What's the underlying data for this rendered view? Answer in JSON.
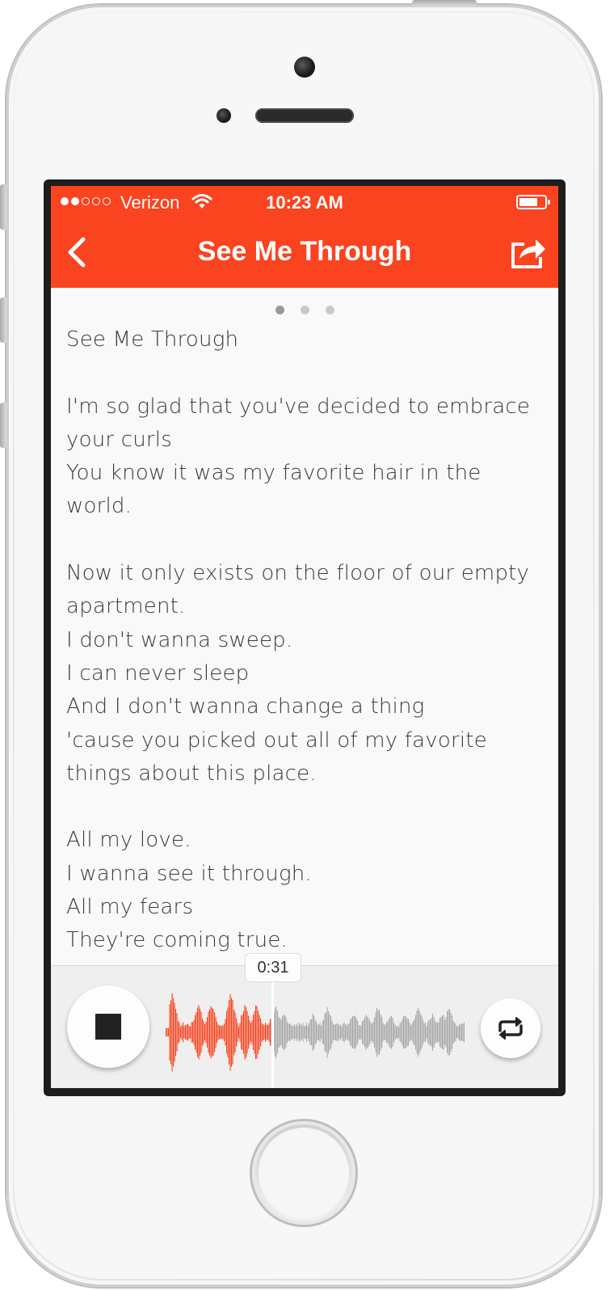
{
  "status_bar": {
    "signal_dots_filled": 2,
    "signal_dots_total": 5,
    "carrier": "Verizon",
    "time": "10:23 AM",
    "battery_level": 0.7
  },
  "nav": {
    "title": "See Me Through",
    "back_icon": "chevron-left-icon",
    "share_icon": "share-icon",
    "accent_color": "#fa431f"
  },
  "pager": {
    "pages": 3,
    "active_page": 1
  },
  "lyrics": {
    "text": "See Me Through\n\nI'm so glad that you've decided to embrace\nyour curls\nYou know it was my favorite hair in the\nworld.\n\nNow it only exists on the floor of our empty\napartment.\nI don't wanna sweep.\nI can never sleep\nAnd I don't wanna change a thing\n'cause you picked out all of my favorite\nthings about this place.\n\nAll my love.\nI wanna see it through.\nAll my fears\nThey're coming true."
  },
  "player": {
    "stop_icon": "stop-icon",
    "repeat_icon": "repeat-icon",
    "current_time": "0:31",
    "progress": 0.35,
    "played_color": "#fa431f",
    "unplayed_color": "#a8a8a8"
  }
}
